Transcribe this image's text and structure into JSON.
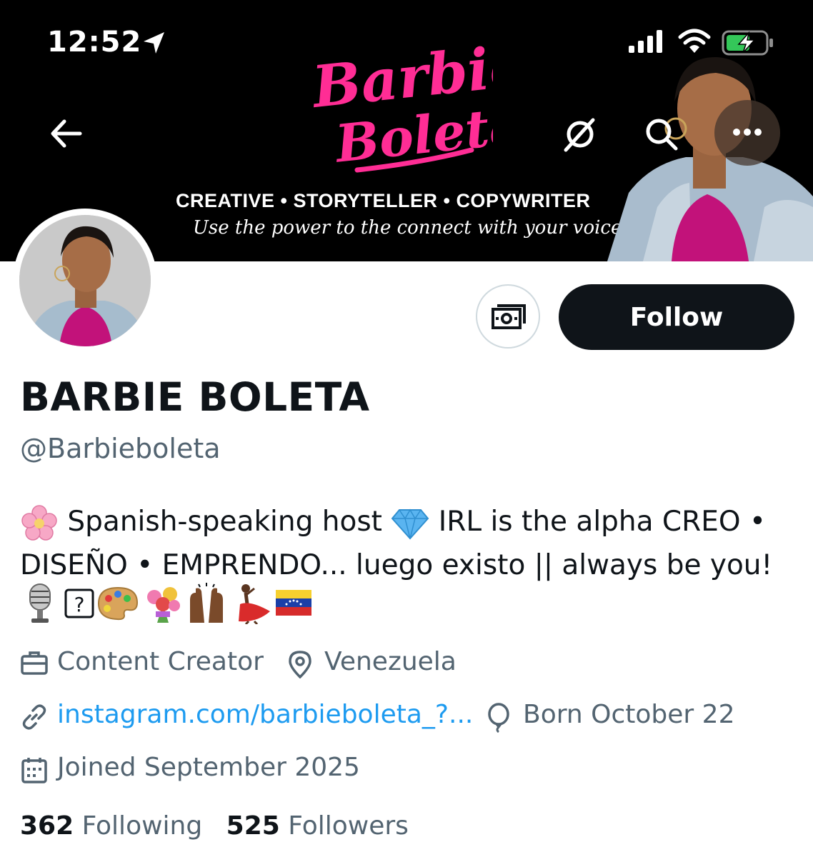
{
  "status_bar": {
    "time": "12:52"
  },
  "header": {
    "logo_text_1": "Barbie",
    "logo_text_2": "Boleta",
    "tagline": "CREATIVE • STORYTELLER • COPYWRITER",
    "subtagline": "Use the power to the connect with your voice!"
  },
  "actions": {
    "follow_label": "Follow"
  },
  "profile": {
    "display_name": "BARBIE BOLETA",
    "handle": "@Barbieboleta",
    "bio_line1_a": "Spanish-speaking host",
    "bio_line1_b": "IRL is the alpha CREO •",
    "bio_line2": "DISEÑO • EMPRENDO... luego existo || always be you!",
    "bio_emoji_icons": [
      "cherry-blossom",
      "gem",
      "microphone",
      "unknown-glyph",
      "artist-palette",
      "bouquet",
      "raising-hands",
      "dancer",
      "venezuela-flag"
    ],
    "category": "Content Creator",
    "location": "Venezuela",
    "website": "instagram.com/barbieboleta_?...",
    "birthday": "Born October 22",
    "joined": "Joined September 2025"
  },
  "stats": {
    "following_count": "362",
    "following_label": "Following",
    "followers_count": "525",
    "followers_label": "Followers"
  },
  "colors": {
    "brand_pink": "#ff2d95",
    "link_blue": "#1d9bf0",
    "secondary_text": "#536471",
    "primary_text": "#0f1419"
  }
}
